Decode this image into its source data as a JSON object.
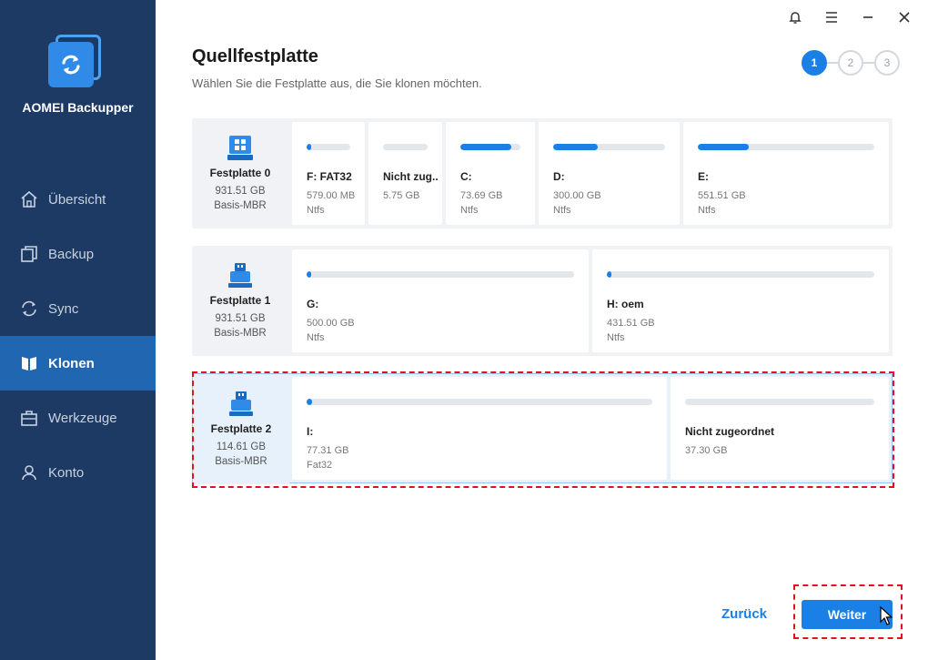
{
  "app": {
    "name": "AOMEI Backupper"
  },
  "sidebar": {
    "items": [
      {
        "label": "Übersicht",
        "icon": "home-icon",
        "active": false
      },
      {
        "label": "Backup",
        "icon": "backup-icon",
        "active": false
      },
      {
        "label": "Sync",
        "icon": "sync-icon",
        "active": false
      },
      {
        "label": "Klonen",
        "icon": "clone-icon",
        "active": true
      },
      {
        "label": "Werkzeuge",
        "icon": "tools-icon",
        "active": false
      },
      {
        "label": "Konto",
        "icon": "user-icon",
        "active": false
      }
    ]
  },
  "header": {
    "title": "Quellfestplatte",
    "subtitle": "Wählen Sie die Festplatte aus, die Sie klonen möchten."
  },
  "steps": [
    "1",
    "2",
    "3"
  ],
  "disks": [
    {
      "name": "Festplatte 0",
      "size": "931.51 GB",
      "type": "Basis-MBR",
      "partitions": [
        {
          "name": "F: FAT32",
          "size": "579.00 MB",
          "fs": "Ntfs",
          "usage": 0.02
        },
        {
          "name": "Nicht zug...",
          "size": "5.75 GB",
          "fs": "",
          "usage": 0
        },
        {
          "name": "C:",
          "size": "73.69 GB",
          "fs": "Ntfs",
          "usage": 0.85
        },
        {
          "name": "D:",
          "size": "300.00 GB",
          "fs": "Ntfs",
          "usage": 0.4
        },
        {
          "name": "E:",
          "size": "551.51 GB",
          "fs": "Ntfs",
          "usage": 0.29
        }
      ]
    },
    {
      "name": "Festplatte 1",
      "size": "931.51 GB",
      "type": "Basis-MBR",
      "partitions": [
        {
          "name": "G:",
          "size": "500.00 GB",
          "fs": "Ntfs",
          "usage": 0.01
        },
        {
          "name": "H: oem",
          "size": "431.51 GB",
          "fs": "Ntfs",
          "usage": 0.01
        }
      ]
    },
    {
      "name": "Festplatte 2",
      "size": "114.61 GB",
      "type": "Basis-MBR",
      "partitions": [
        {
          "name": "I:",
          "size": "77.31 GB",
          "fs": "Fat32",
          "usage": 0.01
        },
        {
          "name": "Nicht zugeordnet",
          "size": "37.30 GB",
          "fs": "",
          "usage": 0
        }
      ]
    }
  ],
  "footer": {
    "back_label": "Zurück",
    "next_label": "Weiter"
  },
  "colors": {
    "sidebar": "#1c3a63",
    "active_nav": "#2166b0",
    "accent": "#1a80e6",
    "highlight": "#e0121b"
  }
}
